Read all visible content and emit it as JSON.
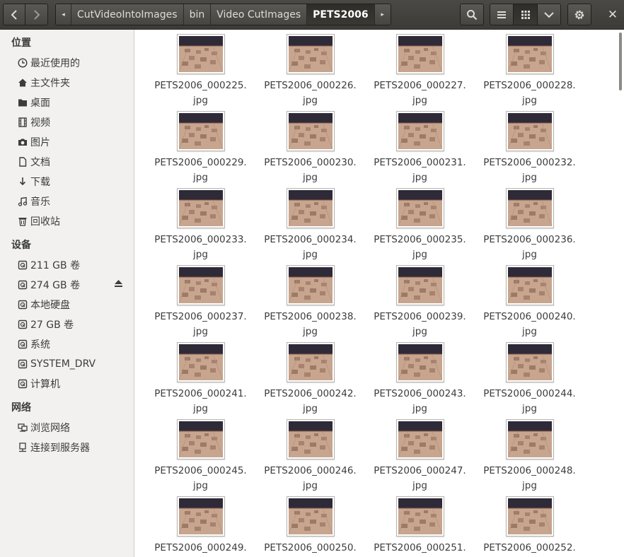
{
  "header": {
    "breadcrumbs": [
      "CutVideoIntoImages",
      "bin",
      "Video CutImages",
      "PETS2006"
    ],
    "close_glyph": "✕"
  },
  "sidebar": {
    "places_title": "位置",
    "places": [
      {
        "label": "最近使用的",
        "icon": "clock-icon"
      },
      {
        "label": "主文件夹",
        "icon": "home-icon"
      },
      {
        "label": "桌面",
        "icon": "folder-icon"
      },
      {
        "label": "视频",
        "icon": "film-icon"
      },
      {
        "label": "图片",
        "icon": "camera-icon"
      },
      {
        "label": "文档",
        "icon": "document-icon"
      },
      {
        "label": "下载",
        "icon": "download-icon"
      },
      {
        "label": "音乐",
        "icon": "music-icon"
      },
      {
        "label": "回收站",
        "icon": "trash-icon"
      }
    ],
    "devices_title": "设备",
    "devices": [
      {
        "label": "211 GB 卷",
        "icon": "drive-icon"
      },
      {
        "label": "274 GB 卷",
        "icon": "drive-icon"
      },
      {
        "label": "本地硬盘",
        "icon": "drive-icon"
      },
      {
        "label": "27 GB 卷",
        "icon": "drive-icon"
      },
      {
        "label": "系统",
        "icon": "drive-icon"
      },
      {
        "label": "SYSTEM_DRV",
        "icon": "drive-icon"
      },
      {
        "label": "计算机",
        "icon": "drive-icon"
      }
    ],
    "network_title": "网络",
    "network": [
      {
        "label": "浏览网络",
        "icon": "network-icon"
      },
      {
        "label": "连接到服务器",
        "icon": "server-icon"
      }
    ]
  },
  "files": [
    {
      "line1": "PETS2006_000225.",
      "line2": "jpg"
    },
    {
      "line1": "PETS2006_000226.",
      "line2": "jpg"
    },
    {
      "line1": "PETS2006_000227.",
      "line2": "jpg"
    },
    {
      "line1": "PETS2006_000228.",
      "line2": "jpg"
    },
    {
      "line1": "PETS2006_000229.",
      "line2": "jpg"
    },
    {
      "line1": "PETS2006_000230.",
      "line2": "jpg"
    },
    {
      "line1": "PETS2006_000231.",
      "line2": "jpg"
    },
    {
      "line1": "PETS2006_000232.",
      "line2": "jpg"
    },
    {
      "line1": "PETS2006_000233.",
      "line2": "jpg"
    },
    {
      "line1": "PETS2006_000234.",
      "line2": "jpg"
    },
    {
      "line1": "PETS2006_000235.",
      "line2": "jpg"
    },
    {
      "line1": "PETS2006_000236.",
      "line2": "jpg"
    },
    {
      "line1": "PETS2006_000237.",
      "line2": "jpg"
    },
    {
      "line1": "PETS2006_000238.",
      "line2": "jpg"
    },
    {
      "line1": "PETS2006_000239.",
      "line2": "jpg"
    },
    {
      "line1": "PETS2006_000240.",
      "line2": "jpg"
    },
    {
      "line1": "PETS2006_000241.",
      "line2": "jpg"
    },
    {
      "line1": "PETS2006_000242.",
      "line2": "jpg"
    },
    {
      "line1": "PETS2006_000243.",
      "line2": "jpg"
    },
    {
      "line1": "PETS2006_000244.",
      "line2": "jpg"
    },
    {
      "line1": "PETS2006_000245.",
      "line2": "jpg"
    },
    {
      "line1": "PETS2006_000246.",
      "line2": "jpg"
    },
    {
      "line1": "PETS2006_000247.",
      "line2": "jpg"
    },
    {
      "line1": "PETS2006_000248.",
      "line2": "jpg"
    },
    {
      "line1": "PETS2006_000249.",
      "line2": ""
    },
    {
      "line1": "PETS2006_000250.",
      "line2": ""
    },
    {
      "line1": "PETS2006_000251.",
      "line2": ""
    },
    {
      "line1": "PETS2006_000252.",
      "line2": ""
    }
  ],
  "colors": {
    "header_bg": "#3c3b37",
    "sidebar_bg": "#f2f1f0",
    "content_bg": "#ffffff",
    "thumb_floor": "#c8a58e",
    "thumb_wall": "#2e2a38"
  }
}
